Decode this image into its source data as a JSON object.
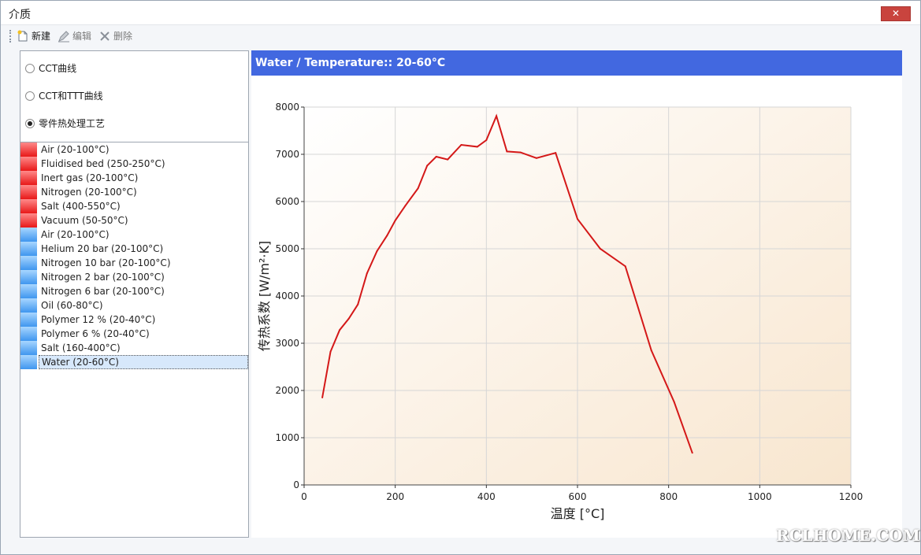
{
  "window": {
    "title": "介质",
    "close_glyph": "✕"
  },
  "toolbar": {
    "new_label": "新建",
    "edit_label": "编辑",
    "delete_label": "删除"
  },
  "radios": [
    {
      "label": "CCT曲线",
      "checked": false
    },
    {
      "label": "CCT和TTT曲线",
      "checked": false
    },
    {
      "label": "零件热处理工艺",
      "checked": true
    }
  ],
  "media": [
    {
      "label": "Air (20-100°C)",
      "color": "red"
    },
    {
      "label": "Fluidised bed (250-250°C)",
      "color": "red"
    },
    {
      "label": "Inert gas (20-100°C)",
      "color": "red"
    },
    {
      "label": "Nitrogen (20-100°C)",
      "color": "red"
    },
    {
      "label": "Salt (400-550°C)",
      "color": "red"
    },
    {
      "label": "Vacuum (50-50°C)",
      "color": "red"
    },
    {
      "label": "Air (20-100°C)",
      "color": "blue"
    },
    {
      "label": "Helium 20 bar (20-100°C)",
      "color": "blue"
    },
    {
      "label": "Nitrogen 10 bar (20-100°C)",
      "color": "blue"
    },
    {
      "label": "Nitrogen 2 bar (20-100°C)",
      "color": "blue"
    },
    {
      "label": "Nitrogen 6 bar (20-100°C)",
      "color": "blue"
    },
    {
      "label": "Oil (60-80°C)",
      "color": "blue"
    },
    {
      "label": "Polymer 12 % (20-40°C)",
      "color": "blue"
    },
    {
      "label": "Polymer 6 % (20-40°C)",
      "color": "blue"
    },
    {
      "label": "Salt (160-400°C)",
      "color": "blue"
    },
    {
      "label": "Water (20-60°C)",
      "color": "blue",
      "selected": true
    }
  ],
  "chart_header": "Water / Temperature:: 20-60°C",
  "chart_data": {
    "type": "line",
    "xlabel": "温度 [°C]",
    "ylabel": "传热系数 [W/m²·K]",
    "xlim": [
      0,
      1200
    ],
    "ylim": [
      0,
      8000
    ],
    "xticks": [
      0,
      200,
      400,
      600,
      800,
      1000,
      1200
    ],
    "yticks": [
      0,
      1000,
      2000,
      3000,
      4000,
      5000,
      6000,
      7000,
      8000
    ],
    "grid": true,
    "line_color": "#d41818",
    "x": [
      40,
      58,
      78,
      98,
      118,
      138,
      160,
      182,
      200,
      222,
      250,
      270,
      290,
      315,
      345,
      380,
      400,
      422,
      445,
      475,
      510,
      552,
      600,
      650,
      705,
      762,
      812,
      852
    ],
    "y": [
      1850,
      2820,
      3280,
      3520,
      3820,
      4480,
      4950,
      5280,
      5600,
      5910,
      6280,
      6760,
      6950,
      6890,
      7200,
      7160,
      7300,
      7810,
      7060,
      7040,
      6920,
      7030,
      5630,
      5000,
      4630,
      2850,
      1760,
      680
    ]
  },
  "watermark": "RCLHOME.COM"
}
